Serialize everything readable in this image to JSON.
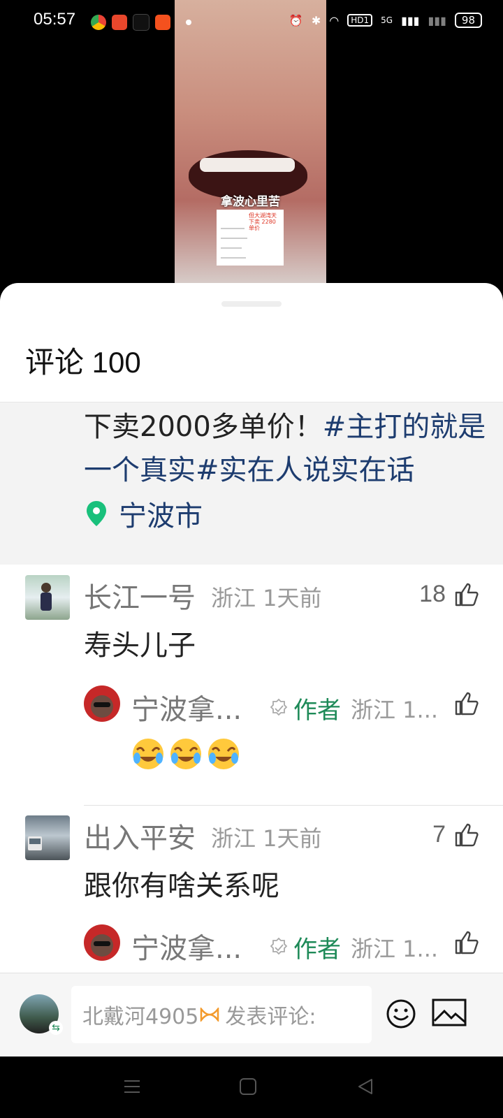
{
  "status_bar": {
    "time": "05:57",
    "app_icons": [
      "chrome-icon",
      "taobao-icon",
      "tiktok-icon",
      "ting-icon"
    ],
    "network_label": "HD1",
    "signal_label": "5G",
    "battery": "98"
  },
  "video": {
    "caption": "拿波心里苦",
    "doc_highlight": "但大湖湾天下卖 2280单价"
  },
  "sheet": {
    "title": "评论 100",
    "post_text_plain": "下卖2000多单价！",
    "post_hashtags": "#主打的就是一个真实#实在人说实在话",
    "location": "宁波市"
  },
  "comments": [
    {
      "name": "长江一号",
      "meta": "浙江 1天前",
      "text": "寿头儿子",
      "likes": "18",
      "reply": {
        "name": "宁波拿...",
        "badge": "作者",
        "meta": "浙江 1...",
        "emojis": [
          "laugh-cry-emoji",
          "laugh-cry-emoji",
          "laugh-cry-emoji"
        ]
      }
    },
    {
      "name": "出入平安",
      "meta": "浙江 1天前",
      "text": "跟你有啥关系呢",
      "likes": "7",
      "reply": {
        "name": "宁波拿...",
        "badge": "作者",
        "meta": "浙江 1..."
      }
    }
  ],
  "input": {
    "username": "北戴河4905",
    "placeholder": "发表评论:"
  },
  "colors": {
    "accent_green": "#1e8a58",
    "hashtag_blue": "#1d3c6f",
    "location_green": "#19c07b"
  }
}
